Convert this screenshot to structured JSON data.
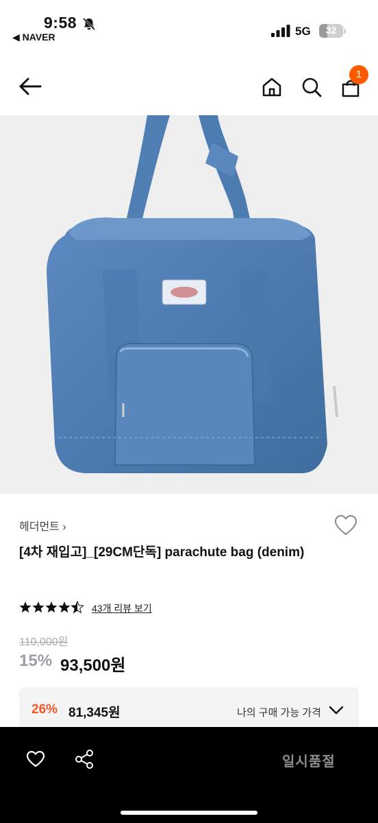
{
  "status_bar": {
    "time": "9:58",
    "back_app": "◀ NAVER",
    "network": "5G",
    "battery": "32"
  },
  "nav": {
    "cart_count": "1"
  },
  "product": {
    "brand": "헤더먼트 ›",
    "title": "[4차 재입고]_[29CM단독] parachute bag (denim)",
    "rating": 4.5,
    "review_link": "43개 리뷰 보기",
    "original_price": "110,000원",
    "discount": "15%",
    "price": "93,500원"
  },
  "my_price": {
    "discount": "26%",
    "price": "81,345원",
    "label": "나의 구매 가능 가격"
  },
  "bottom_bar": {
    "soldout_label": "일시품절"
  },
  "colors": {
    "accent": "#ff5a00",
    "discount_red": "#f05a28",
    "denim": "#4f7fb3"
  }
}
